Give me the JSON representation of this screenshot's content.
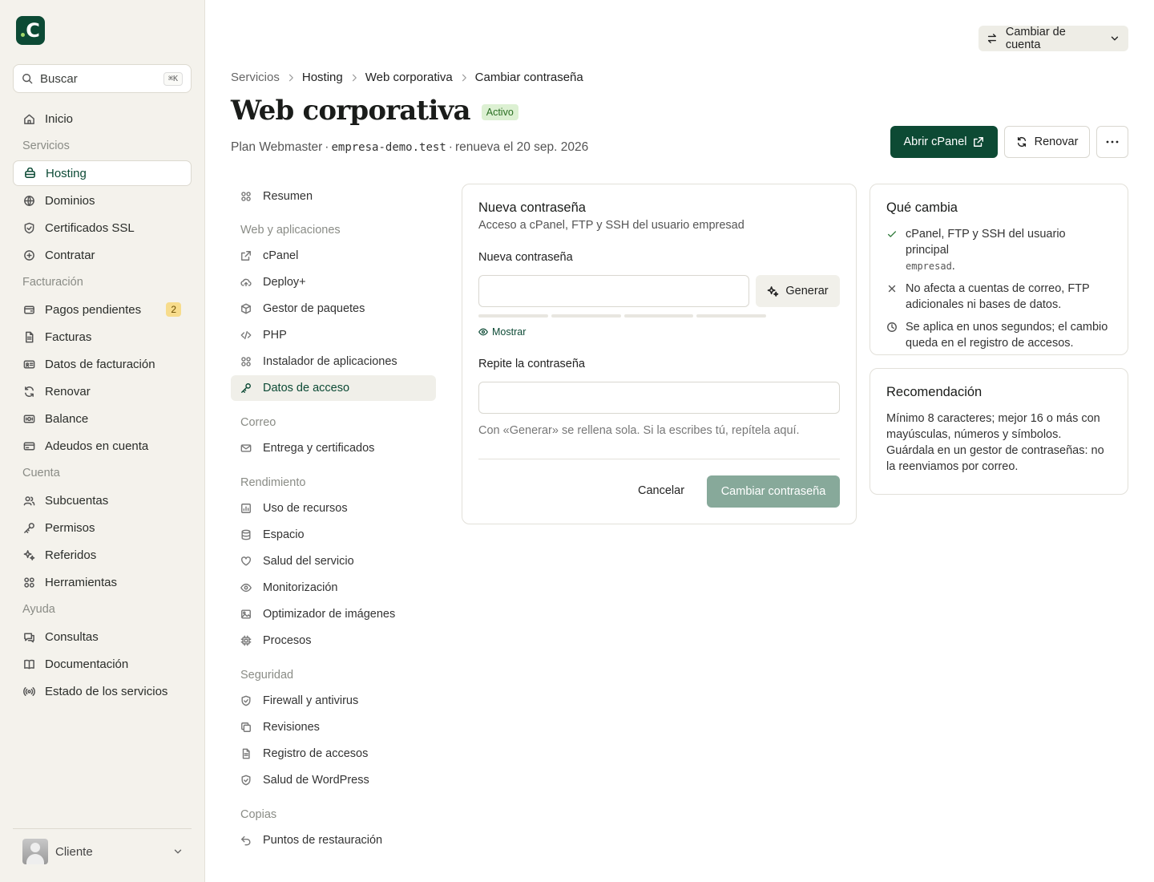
{
  "logo": {
    "letter": "C"
  },
  "search": {
    "placeholder": "Buscar",
    "shortcut": "⌘K"
  },
  "sidebar": {
    "items": [
      {
        "type": "item",
        "label": "Inicio",
        "icon": "home-icon"
      },
      {
        "type": "section",
        "label": "Servicios"
      },
      {
        "type": "item",
        "label": "Hosting",
        "icon": "server-icon",
        "active": true
      },
      {
        "type": "item",
        "label": "Dominios",
        "icon": "globe-icon"
      },
      {
        "type": "item",
        "label": "Certificados SSL",
        "icon": "shield-icon"
      },
      {
        "type": "item",
        "label": "Contratar",
        "icon": "plus-circle-icon"
      },
      {
        "type": "section",
        "label": "Facturación"
      },
      {
        "type": "item",
        "label": "Pagos pendientes",
        "icon": "wallet-icon",
        "badge": "2"
      },
      {
        "type": "item",
        "label": "Facturas",
        "icon": "file-icon"
      },
      {
        "type": "item",
        "label": "Datos de facturación",
        "icon": "id-card-icon"
      },
      {
        "type": "item",
        "label": "Renovar",
        "icon": "refresh-icon"
      },
      {
        "type": "item",
        "label": "Balance",
        "icon": "banknote-icon"
      },
      {
        "type": "item",
        "label": "Adeudos en cuenta",
        "icon": "credit-card-icon"
      },
      {
        "type": "section",
        "label": "Cuenta"
      },
      {
        "type": "item",
        "label": "Subcuentas",
        "icon": "users-icon"
      },
      {
        "type": "item",
        "label": "Permisos",
        "icon": "key-icon"
      },
      {
        "type": "item",
        "label": "Referidos",
        "icon": "sparkles-icon"
      },
      {
        "type": "item",
        "label": "Herramientas",
        "icon": "grid-icon"
      },
      {
        "type": "section",
        "label": "Ayuda"
      },
      {
        "type": "item",
        "label": "Consultas",
        "icon": "chat-icon"
      },
      {
        "type": "item",
        "label": "Documentación",
        "icon": "book-icon"
      },
      {
        "type": "item",
        "label": "Estado de los servicios",
        "icon": "radio-icon"
      }
    ]
  },
  "user": {
    "name": "Cliente"
  },
  "header": {
    "account_switch": "Cambiar de cuenta",
    "breadcrumb": [
      "Servicios",
      "Hosting",
      "Web corporativa",
      "Cambiar contraseña"
    ],
    "title": "Web corporativa",
    "status": "Activo",
    "plan": "Plan Webmaster",
    "domain": "empresa-demo.test",
    "renew": "renueva el 20 sep. 2026",
    "dot": "·",
    "open_cpanel": "Abrir cPanel",
    "renew_button": "Renovar"
  },
  "subnav": [
    {
      "type": "item",
      "label": "Resumen",
      "icon": "grid-icon"
    },
    {
      "type": "section",
      "label": "Web y aplicaciones"
    },
    {
      "type": "item",
      "label": "cPanel",
      "icon": "external-link-icon"
    },
    {
      "type": "item",
      "label": "Deploy+",
      "icon": "cloud-upload-icon"
    },
    {
      "type": "item",
      "label": "Gestor de paquetes",
      "icon": "package-icon"
    },
    {
      "type": "item",
      "label": "PHP",
      "icon": "code-icon"
    },
    {
      "type": "item",
      "label": "Instalador de aplicaciones",
      "icon": "grid-icon"
    },
    {
      "type": "item",
      "label": "Datos de acceso",
      "icon": "key-icon",
      "active": true
    },
    {
      "type": "section",
      "label": "Correo"
    },
    {
      "type": "item",
      "label": "Entrega y certificados",
      "icon": "mail-icon"
    },
    {
      "type": "section",
      "label": "Rendimiento"
    },
    {
      "type": "item",
      "label": "Uso de recursos",
      "icon": "chart-icon"
    },
    {
      "type": "item",
      "label": "Espacio",
      "icon": "database-icon"
    },
    {
      "type": "item",
      "label": "Salud del servicio",
      "icon": "heart-icon"
    },
    {
      "type": "item",
      "label": "Monitorización",
      "icon": "eye-icon"
    },
    {
      "type": "item",
      "label": "Optimizador de imágenes",
      "icon": "image-icon"
    },
    {
      "type": "item",
      "label": "Procesos",
      "icon": "cpu-icon"
    },
    {
      "type": "section",
      "label": "Seguridad"
    },
    {
      "type": "item",
      "label": "Firewall y antivirus",
      "icon": "shield-icon"
    },
    {
      "type": "item",
      "label": "Revisiones",
      "icon": "copy-icon"
    },
    {
      "type": "item",
      "label": "Registro de accesos",
      "icon": "file-icon"
    },
    {
      "type": "item",
      "label": "Salud de WordPress",
      "icon": "shield-icon"
    },
    {
      "type": "section",
      "label": "Copias"
    },
    {
      "type": "item",
      "label": "Puntos de restauración",
      "icon": "undo-icon"
    }
  ],
  "form": {
    "title": "Nueva contraseña",
    "description": "Acceso a cPanel, FTP y SSH del usuario empresad",
    "password_label": "Nueva contraseña",
    "password_value": "",
    "generate": "Generar",
    "show": "Mostrar",
    "repeat_label": "Repite la contraseña",
    "repeat_value": "",
    "hint": "Con «Generar» se rellena sola. Si la escribes tú, repítela aquí.",
    "cancel": "Cancelar",
    "submit": "Cambiar contraseña"
  },
  "changes": {
    "title": "Qué cambia",
    "item1_text": "cPanel, FTP y SSH del usuario principal",
    "item1_user": "empresad",
    "item1_end": ".",
    "item2": "No afecta a cuentas de correo, FTP adicionales ni bases de datos.",
    "item3": "Se aplica en unos segundos; el cambio queda en el registro de accesos."
  },
  "recommendation": {
    "title": "Recomendación",
    "text": "Mínimo 8 caracteres; mejor 16 o más con mayúsculas, números y símbolos. Guárdala en un gestor de contraseñas: no la reenviamos por correo."
  },
  "colors": {
    "brand": "#0d4a34",
    "badge": "#f7dc8c",
    "status_bg": "#dcf0d2",
    "submit_disabled": "#87a99a"
  }
}
